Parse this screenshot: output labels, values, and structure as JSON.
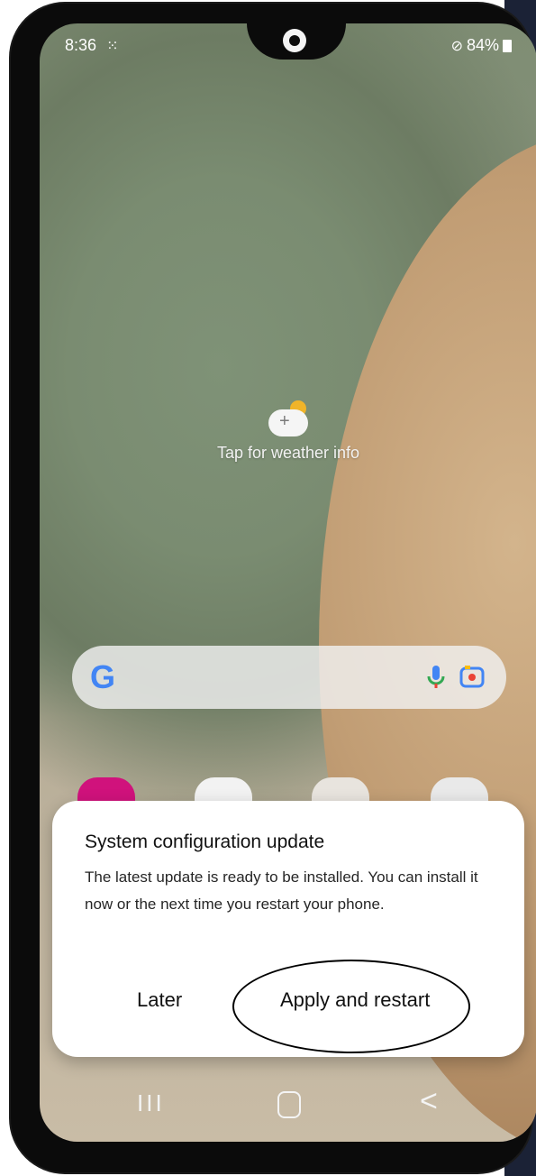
{
  "status_bar": {
    "time": "8:36",
    "battery": "84%"
  },
  "weather": {
    "label": "Tap for weather info"
  },
  "search_bar": {
    "logo": "G"
  },
  "dialog": {
    "title": "System configuration update",
    "body": "The latest update is ready to be installed. You can install it now or the next time you restart your phone.",
    "later_label": "Later",
    "apply_label": "Apply and restart"
  },
  "nav_bar": {
    "recent_label": "III",
    "back_label": "<"
  },
  "icons": {
    "status_notification": "grid-dots-icon",
    "status_dnd": "do-not-disturb-icon",
    "battery": "battery-icon",
    "weather": "cloud-plus-sun-icon",
    "mic": "microphone-icon",
    "lens": "camera-lens-icon",
    "home": "home-icon"
  },
  "colors": {
    "google_blue": "#4285f4",
    "google_red": "#ea4335",
    "google_yellow": "#fbbc05",
    "google_green": "#34a853",
    "dialog_bg": "#ffffff"
  }
}
